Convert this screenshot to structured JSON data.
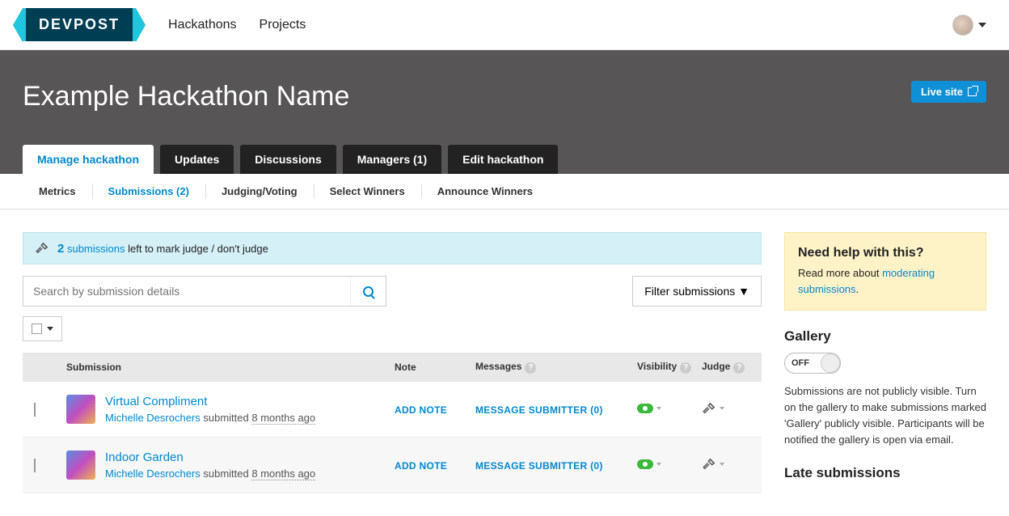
{
  "topnav": {
    "brand": "DEVPOST",
    "links": [
      "Hackathons",
      "Projects"
    ]
  },
  "hero": {
    "title": "Example Hackathon Name",
    "live_button": "Live site"
  },
  "hero_tabs": [
    "Manage hackathon",
    "Updates",
    "Discussions",
    "Managers (1)",
    "Edit hackathon"
  ],
  "subtabs": [
    "Metrics",
    "Submissions (2)",
    "Judging/Voting",
    "Select Winners",
    "Announce Winners"
  ],
  "alert": {
    "count": "2",
    "link_text": "submissions",
    "rest": " left to mark judge / don't judge"
  },
  "search": {
    "placeholder": "Search by submission details"
  },
  "filter_label": "Filter submissions ▼",
  "table": {
    "headers": {
      "submission": "Submission",
      "note": "Note",
      "messages": "Messages",
      "visibility": "Visibility",
      "judge": "Judge"
    },
    "rows": [
      {
        "title": "Virtual Compliment",
        "author": "Michelle Desrochers",
        "submitted_word": " submitted ",
        "time": "8 months ago",
        "add_note": "ADD NOTE",
        "message": "MESSAGE SUBMITTER (0)"
      },
      {
        "title": "Indoor Garden",
        "author": "Michelle Desrochers",
        "submitted_word": " submitted ",
        "time": "8 months ago",
        "add_note": "ADD NOTE",
        "message": "MESSAGE SUBMITTER (0)"
      }
    ]
  },
  "help": {
    "title": "Need help with this?",
    "pre": "Read more about ",
    "link": "moderating submissions",
    "post": "."
  },
  "gallery": {
    "heading": "Gallery",
    "toggle_label": "OFF",
    "desc": "Submissions are not publicly visible. Turn on the gallery to make submissions marked 'Gallery' publicly visible. Participants will be notified the gallery is open via email."
  },
  "late": {
    "heading": "Late submissions"
  }
}
